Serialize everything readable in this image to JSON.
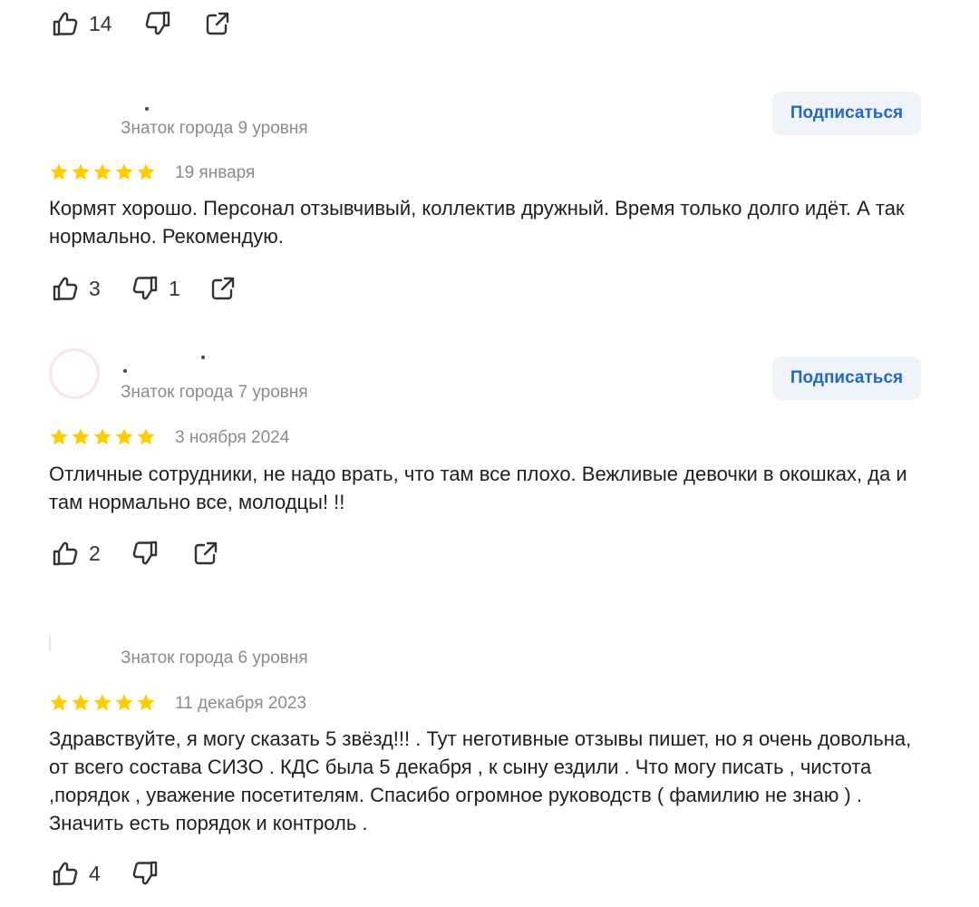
{
  "colors": {
    "star": "#ffcc00",
    "subscribe_bg": "#eef3fa",
    "subscribe_text": "#2468c4",
    "muted": "#8b8b8b"
  },
  "icons": {
    "like": "thumb-up-icon",
    "dislike": "thumb-down-icon",
    "share": "share-icon",
    "star": "star-icon"
  },
  "top_actions": {
    "likes": "14"
  },
  "reviews": [
    {
      "level": "Знаток города 9 уровня",
      "subscribe_label": "Подписаться",
      "rating": 5,
      "date": "19 января",
      "text": "Кормят хорошо. Персонал отзывчивый, коллектив дружный. Время только долго идёт. А так нормально. Рекомендую.",
      "likes": "3",
      "dislikes": "1"
    },
    {
      "level": "Знаток города 7 уровня",
      "subscribe_label": "Подписаться",
      "rating": 5,
      "date": "3 ноября 2024",
      "text": "Отличные сотрудники, не надо врать, что там все плохо. Вежливые девочки в окошках, да и там нормально все, молодцы! !!",
      "likes": "2"
    },
    {
      "level": "Знаток города 6 уровня",
      "rating": 5,
      "date": "11 декабря 2023",
      "text": "Здравствуйте, я могу сказать 5 звёзд!!! . Тут неготивные отзывы пишет, но я очень довольна, от всего состава СИЗО . КДС была 5 декабря , к сыну ездили . Что могу писать , чистота ,порядок , уважение посетителям. Спасибо огромное руководств ( фамилию не знаю ) . Значить есть порядок и контроль .",
      "likes": "4"
    }
  ]
}
